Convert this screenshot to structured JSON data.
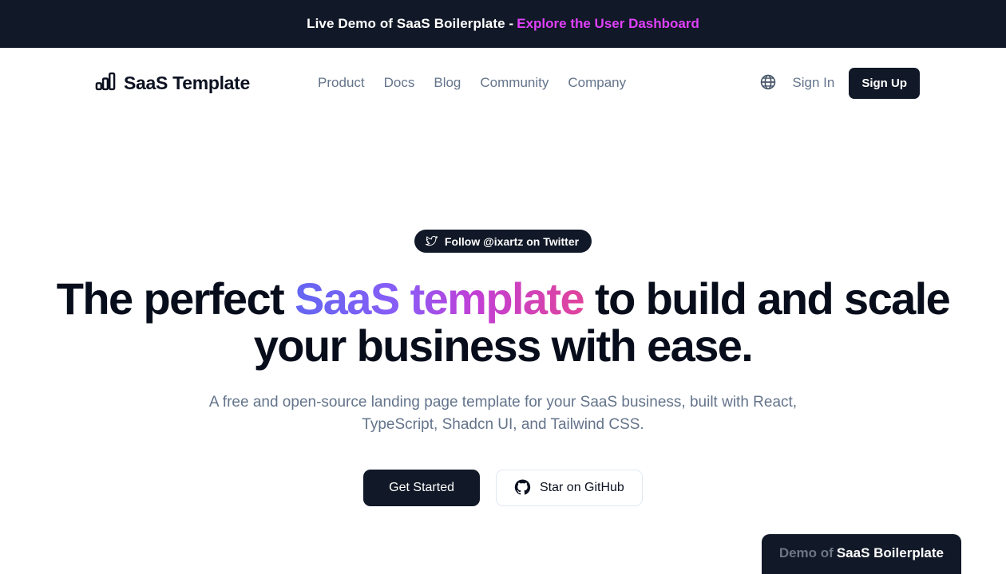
{
  "banner": {
    "text": "Live Demo of SaaS Boilerplate -",
    "link_label": "Explore the User Dashboard",
    "link_color": "#e040fb",
    "background": "#111827"
  },
  "navbar": {
    "logo_icon": "bar-chart-icon",
    "brand_name": "SaaS Template",
    "links": [
      {
        "label": "Product"
      },
      {
        "label": "Docs"
      },
      {
        "label": "Blog"
      },
      {
        "label": "Community"
      },
      {
        "label": "Company"
      }
    ],
    "locale_icon": "globe-icon",
    "sign_in_label": "Sign In",
    "sign_up_label": "Sign Up"
  },
  "hero": {
    "badge": {
      "icon": "twitter-bird-icon",
      "label": "Follow @ixartz on Twitter"
    },
    "headline_part1": "The perfect ",
    "headline_highlight": "SaaS template",
    "headline_part2": " to build and scale your business with ease.",
    "highlight_gradient_from": "#6366f1",
    "highlight_gradient_to": "#e0449b",
    "subtitle": "A free and open-source landing page template for your SaaS business, built with React, TypeScript, Shadcn UI, and Tailwind CSS.",
    "primary_cta": "Get Started",
    "secondary_cta": "Star on GitHub",
    "secondary_cta_icon": "github-icon"
  },
  "demo_badge": {
    "prefix": "Demo of",
    "name": "SaaS Boilerplate"
  }
}
